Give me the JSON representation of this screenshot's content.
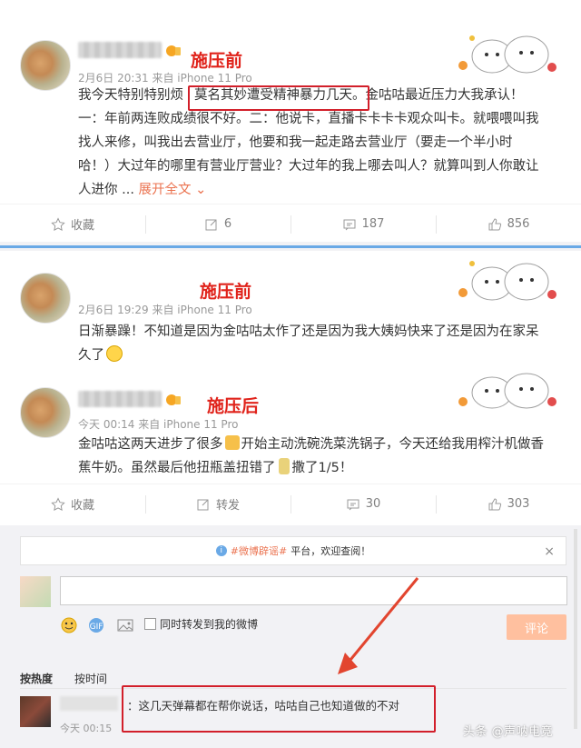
{
  "posts": [
    {
      "tag": "施压前",
      "meta": "2月6日 20:31 来自 iPhone 11 Pro",
      "lines": [
        "我今天特别特别烦",
        "莫名其妙遭受精神暴力几天",
        "。金咕咕最近压力大我承认！",
        "一：年前两连败成绩很不好。二：他说卡，直播卡卡卡卡观众叫卡。就喂喂叫我",
        "找人来修，叫我出去营业厅，他要和我一起走路去营业厅（要走一个半小时",
        "哈！）大过年的哪里有营业厅营业？大过年的我上哪去叫人？就算叫到人你敢让",
        "人进你 ..."
      ],
      "expand": "展开全文",
      "actions": {
        "favorite": "收藏",
        "repost": "6",
        "comment": "187",
        "like": "856"
      }
    },
    {
      "tag": "施压前",
      "meta": "2月6日 19:29 来自 iPhone 11 Pro",
      "lines": [
        "日渐暴躁！不知道是因为金咕咕太作了还是因为我大姨妈快来了还是因为在家呆",
        "久了"
      ]
    },
    {
      "tag": "施压后",
      "meta": "今天 00:14 来自 iPhone 11 Pro",
      "lines": [
        "金咕咕这两天进步了很多",
        "开始主动洗碗洗菜洗锅子，今天还给我用榨汁机做香",
        "蕉牛奶。虽然最后他扭瓶盖扭错了",
        "撒了1/5！"
      ],
      "actions": {
        "favorite": "收藏",
        "repost": "转发",
        "comment": "30",
        "like": "303"
      }
    }
  ],
  "comment_panel": {
    "notice_hash": "#微博辟谣#",
    "notice_text": "平台，欢迎查阅！",
    "notice_close": "×",
    "sync_label": "同时转发到我的微博",
    "submit": "评论",
    "sort_hot": "按热度",
    "sort_time": "按时间",
    "comment_text": "：这几天弹幕都在帮你说话，咕咕自己也知道做的不对",
    "comment_time": "今天 00:15"
  },
  "watermark": "头条 @声呐电竞",
  "colors": {
    "tag_red": "#e0231b",
    "highlight_box": "#d21f2a",
    "arrow": "#e2452f",
    "link_orange": "#eb7350"
  }
}
